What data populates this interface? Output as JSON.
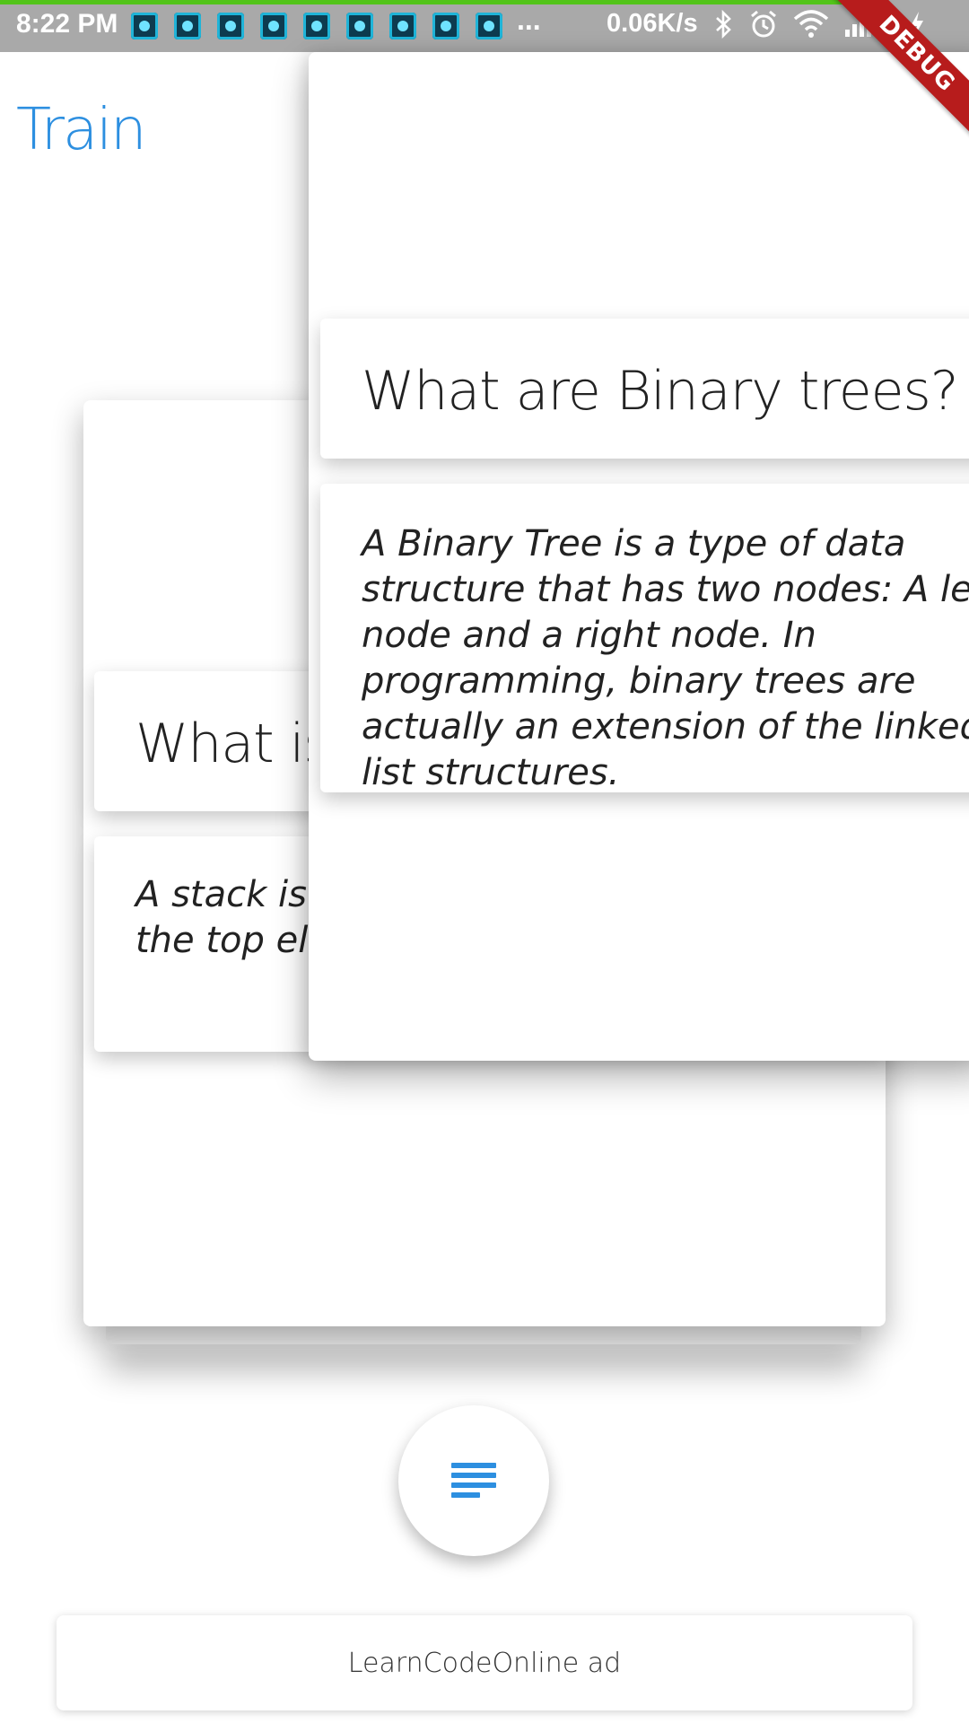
{
  "status_bar": {
    "time": "8:22 PM",
    "more": "...",
    "network_speed": "0.06K/s",
    "notification_icons": [
      "app-icon",
      "app-icon",
      "app-icon",
      "app-icon",
      "app-icon",
      "app-icon",
      "app-icon",
      "app-icon",
      "app-icon"
    ],
    "right_icons": [
      "bluetooth-icon",
      "alarm-icon",
      "wifi-icon",
      "signal-icon",
      "charging-icon"
    ],
    "colors": {
      "bar": "#a9a9a9",
      "progress": "#52c41a"
    }
  },
  "debug_banner": "DEBUG",
  "header": {
    "title": "Train",
    "title_color": "#2d8fe0"
  },
  "cards": {
    "back": {
      "question": "What is a stack?",
      "answer": "A stack is a data structure in which only the top element can be accessed."
    },
    "front": {
      "question": "What are Binary trees?",
      "answer": "A Binary Tree is a type of data structure that has two nodes: A left node and a right node. In programming, binary trees are actually an extension of the linked list structures."
    }
  },
  "fab": {
    "icon": "list-icon"
  },
  "ad": {
    "label": "LearnCodeOnline ad"
  }
}
